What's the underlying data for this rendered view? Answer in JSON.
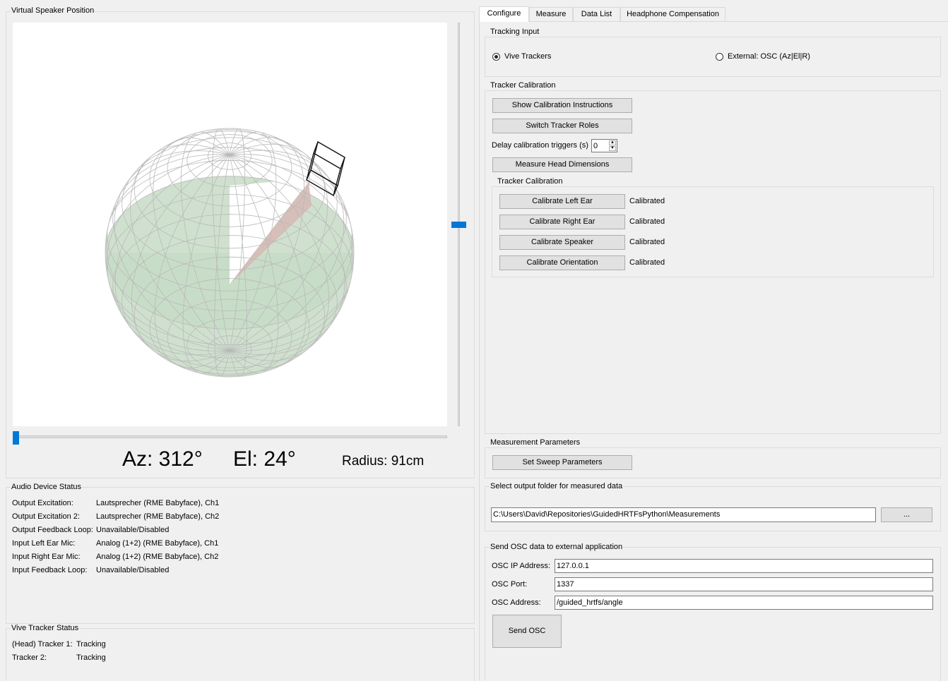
{
  "left": {
    "viz_title": "Virtual Speaker Position",
    "readout": {
      "az": "Az: 312°",
      "el": "El: 24°",
      "radius": "Radius: 91cm"
    },
    "audio_status": {
      "title": "Audio Device Status",
      "rows": [
        {
          "label": "Output Excitation:",
          "value": "Lautsprecher (RME Babyface), Ch1"
        },
        {
          "label": "Output Excitation 2:",
          "value": "Lautsprecher (RME Babyface), Ch2"
        },
        {
          "label": "Output Feedback Loop:",
          "value": "Unavailable/Disabled"
        },
        {
          "label": "Input Left Ear Mic:",
          "value": "Analog (1+2) (RME Babyface), Ch1"
        },
        {
          "label": "Input Right Ear Mic:",
          "value": "Analog (1+2) (RME Babyface), Ch2"
        },
        {
          "label": "Input Feedback Loop:",
          "value": "Unavailable/Disabled"
        }
      ]
    },
    "tracker_status": {
      "title": "Vive Tracker Status",
      "rows": [
        {
          "label": "(Head) Tracker 1:",
          "value": "Tracking"
        },
        {
          "label": "Tracker 2:",
          "value": "Tracking"
        }
      ]
    }
  },
  "tabs": [
    "Configure",
    "Measure",
    "Data List",
    "Headphone Compensation"
  ],
  "tracking_input": {
    "title": "Tracking Input",
    "option_vive": "Vive Trackers",
    "option_osc": "External: OSC (Az|El|R)",
    "selected": "vive"
  },
  "tracker_calibration": {
    "title": "Tracker Calibration",
    "show_instructions": "Show Calibration Instructions",
    "switch_roles": "Switch Tracker Roles",
    "delay_label": "Delay calibration triggers (s)",
    "delay_value": "0",
    "measure_head": "Measure Head Dimensions",
    "inner_title": "Tracker Calibration",
    "items": [
      {
        "button": "Calibrate Left Ear",
        "status": "Calibrated"
      },
      {
        "button": "Calibrate Right Ear",
        "status": "Calibrated"
      },
      {
        "button": "Calibrate Speaker",
        "status": "Calibrated"
      },
      {
        "button": "Calibrate Orientation",
        "status": "Calibrated"
      }
    ]
  },
  "measurement_params": {
    "title": "Measurement Parameters",
    "sweep_button": "Set Sweep Parameters"
  },
  "output_folder": {
    "title": "Select output folder for measured data",
    "path": "C:\\Users\\David\\Repositories\\GuidedHRTFsPython\\Measurements",
    "browse": "..."
  },
  "osc": {
    "title": "Send OSC data to external application",
    "ip_label": "OSC IP Address:",
    "ip_value": "127.0.0.1",
    "port_label": "OSC Port:",
    "port_value": "1337",
    "address_label": "OSC Address:",
    "address_value": "/guided_hrtfs/angle",
    "send_button": "Send OSC"
  },
  "colors": {
    "accent": "#0078d7",
    "lower_hemisphere": "#c7dcc6",
    "direction_wedge": "#d7b7b5",
    "wire": "#b9b9b9"
  },
  "slider_values": {
    "horizontal_fraction": 0.0,
    "vertical_fraction": 0.5
  }
}
